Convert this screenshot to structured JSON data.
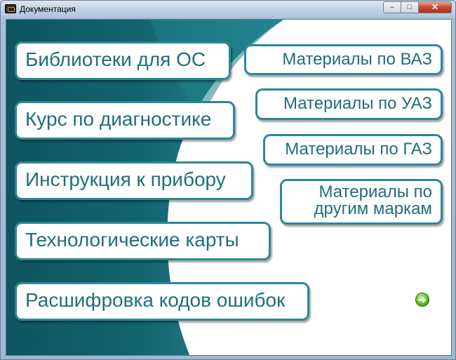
{
  "window": {
    "title": "Документация",
    "controls": {
      "minimize": "–",
      "maximize": "□",
      "close": "✕"
    }
  },
  "menu": {
    "left": [
      "Библиотеки для ОС",
      "Курс по диагностике",
      "Инструкция к прибору",
      "Технологические карты",
      "Расшифровка кодов ошибок"
    ],
    "right": [
      "Материалы по ВАЗ",
      "Материалы по УАЗ",
      "Материалы по ГАЗ",
      [
        "Материалы по",
        "другим маркам"
      ]
    ]
  },
  "colors": {
    "teal_dark": "#0e5560",
    "teal_mid": "#1e7d88",
    "button_border": "#2c8895",
    "button_text": "#1f6e7c"
  },
  "icons": {
    "app": "app-icon",
    "next": "green-arrow-right-icon"
  }
}
